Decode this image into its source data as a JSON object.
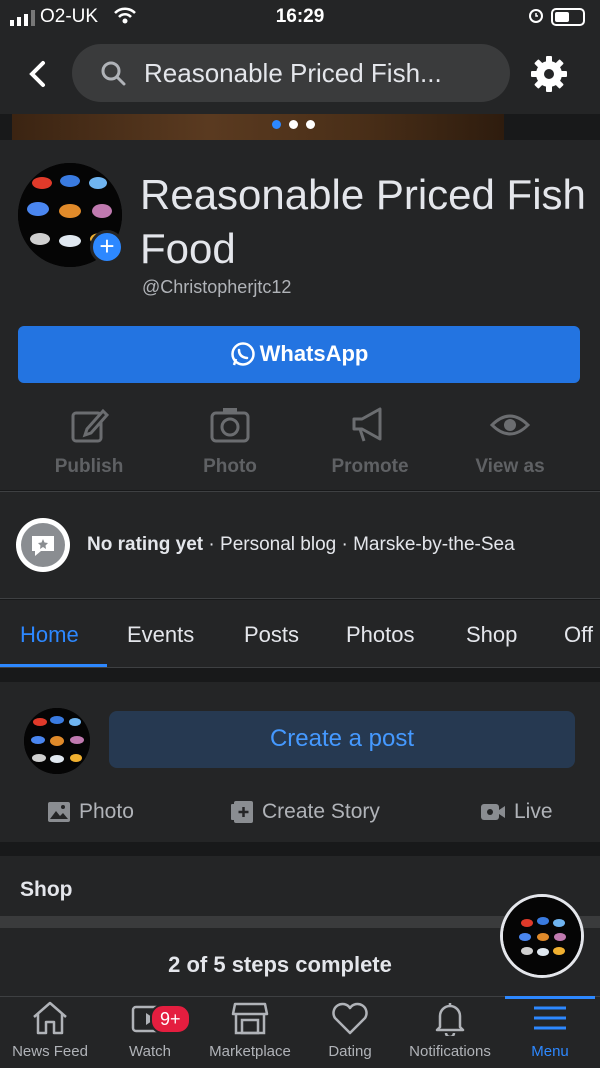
{
  "status_bar": {
    "carrier": "O2-UK",
    "time": "16:29"
  },
  "header": {
    "search_text": "Reasonable Priced Fish..."
  },
  "profile": {
    "name": "Reasonable Priced Fish Food",
    "handle": "@Christopherjtc12",
    "whatsapp_label": "WhatsApp",
    "actions": [
      {
        "label": "Publish",
        "icon": "edit-icon"
      },
      {
        "label": "Photo",
        "icon": "camera-icon"
      },
      {
        "label": "Promote",
        "icon": "megaphone-icon"
      },
      {
        "label": "View as",
        "icon": "eye-icon"
      }
    ]
  },
  "info": {
    "rating": "No rating yet",
    "category": "Personal blog",
    "location": "Marske-by-the-Sea"
  },
  "tabs": [
    "Home",
    "Events",
    "Posts",
    "Photos",
    "Shop",
    "Off"
  ],
  "create_post": {
    "button_label": "Create a post",
    "quick_actions": [
      "Photo",
      "Create Story",
      "Live"
    ]
  },
  "shop_section": {
    "title": "Shop"
  },
  "steps": {
    "text": "2 of 5 steps complete"
  },
  "bottom_nav": {
    "items": [
      "News Feed",
      "Watch",
      "Marketplace",
      "Dating",
      "Notifications",
      "Menu"
    ],
    "watch_badge": "9+"
  },
  "colors": {
    "accent": "#2d88ff",
    "whatsapp_button": "#2374e1",
    "badge": "#e41e3f"
  }
}
